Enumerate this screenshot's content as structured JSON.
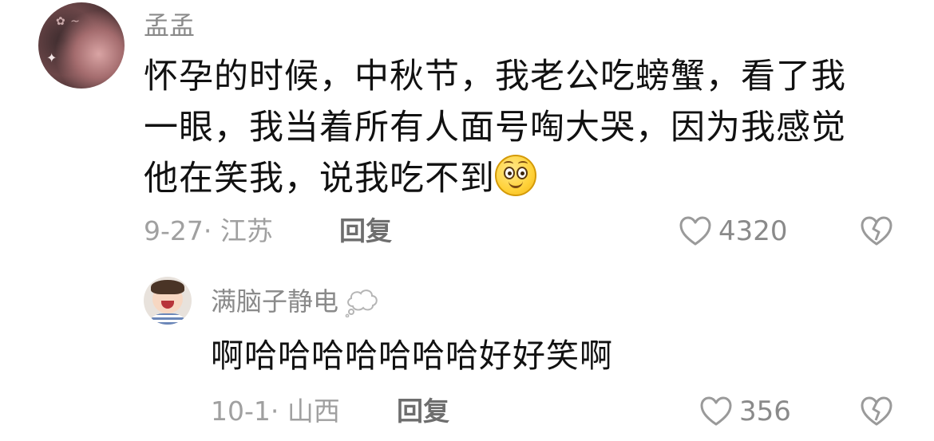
{
  "comment": {
    "username": "孟孟",
    "text_line1": "怀孕的时候，中秋节，我老公吃螃蟹，看了我",
    "text_line2": "一眼，我当着所有人面号啕大哭，因为我感觉",
    "text_line3": "他在笑我，说我吃不到",
    "emoji_icon": "smiling-face-emoji",
    "date": "9-27",
    "location": "江苏",
    "reply_label": "回复",
    "like_count": "4320"
  },
  "reply": {
    "username": "满脑子静电",
    "badge_icon": "thought-bubble-icon",
    "text": "啊哈哈哈哈哈哈哈好好笑啊",
    "date": "10-1",
    "location": "山西",
    "reply_label": "回复",
    "like_count": "356"
  },
  "colors": {
    "text_primary": "#111111",
    "text_secondary": "#8a8a8a",
    "text_meta": "#a0a0a0",
    "icon_gray": "#9a9a9a"
  }
}
